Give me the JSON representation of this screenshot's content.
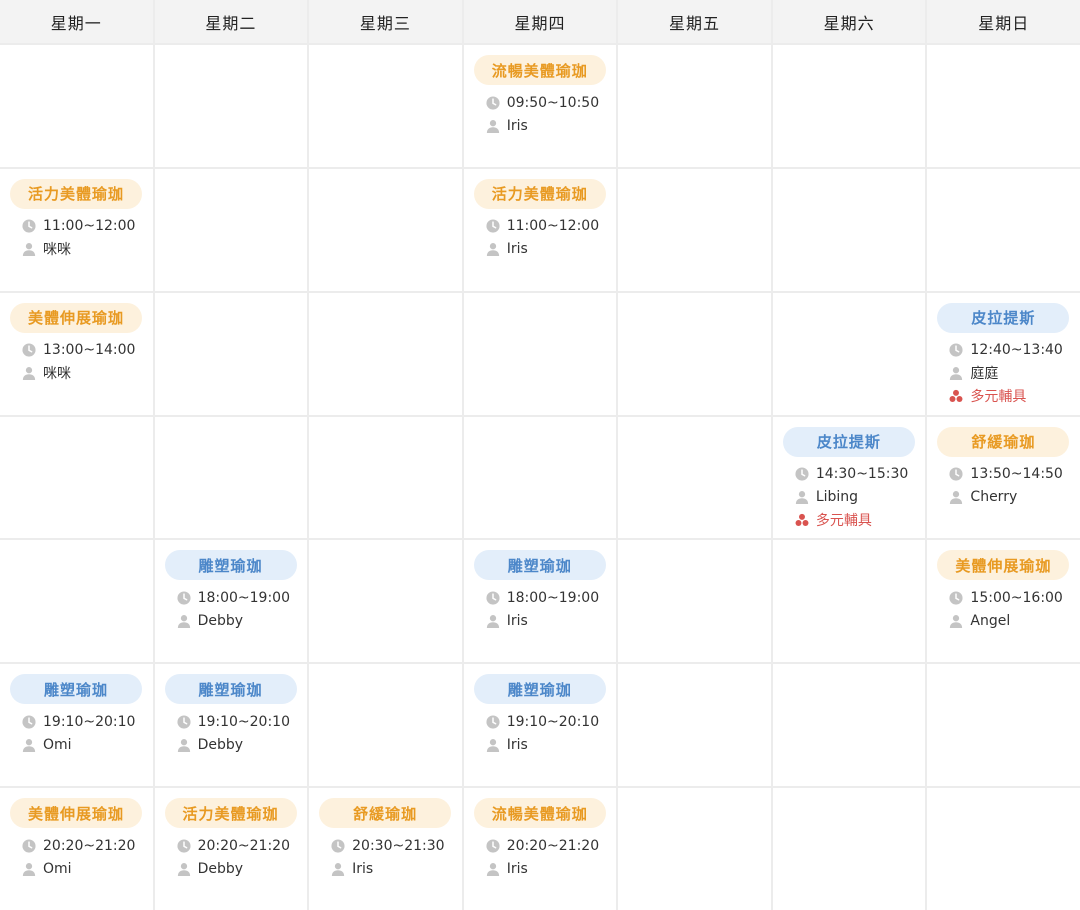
{
  "days": [
    "星期一",
    "星期二",
    "星期三",
    "星期四",
    "星期五",
    "星期六",
    "星期日"
  ],
  "colors": {
    "orange_text": "#e89a22",
    "orange_bg": "#fdf1dd",
    "blue_text": "#4c87c9",
    "blue_bg": "#e3eefa",
    "equip": "#d9534f",
    "icon": "#c2c2c2"
  },
  "icons": {
    "time": "clock-icon",
    "teacher": "person-icon",
    "equipment": "equipment-icon"
  },
  "classes": [
    {
      "day": 3,
      "slot": 0,
      "name": "流暢美體瑜珈",
      "color": "orange",
      "time": "09:50~10:50",
      "teacher": "Iris"
    },
    {
      "day": 0,
      "slot": 1,
      "name": "活力美體瑜珈",
      "color": "orange",
      "time": "11:00~12:00",
      "teacher": "咪咪"
    },
    {
      "day": 3,
      "slot": 1,
      "name": "活力美體瑜珈",
      "color": "orange",
      "time": "11:00~12:00",
      "teacher": "Iris"
    },
    {
      "day": 0,
      "slot": 2,
      "name": "美體伸展瑜珈",
      "color": "orange",
      "time": "13:00~14:00",
      "teacher": "咪咪"
    },
    {
      "day": 6,
      "slot": 2,
      "name": "皮拉提斯",
      "color": "blue",
      "time": "12:40~13:40",
      "teacher": "庭庭",
      "equipment": "多元輔具"
    },
    {
      "day": 5,
      "slot": 3,
      "name": "皮拉提斯",
      "color": "blue",
      "time": "14:30~15:30",
      "teacher": "Libing",
      "equipment": "多元輔具"
    },
    {
      "day": 6,
      "slot": 3,
      "name": "舒緩瑜珈",
      "color": "orange",
      "time": "13:50~14:50",
      "teacher": "Cherry"
    },
    {
      "day": 1,
      "slot": 4,
      "name": "雕塑瑜珈",
      "color": "blue",
      "time": "18:00~19:00",
      "teacher": "Debby"
    },
    {
      "day": 3,
      "slot": 4,
      "name": "雕塑瑜珈",
      "color": "blue",
      "time": "18:00~19:00",
      "teacher": "Iris"
    },
    {
      "day": 6,
      "slot": 4,
      "name": "美體伸展瑜珈",
      "color": "orange",
      "time": "15:00~16:00",
      "teacher": "Angel"
    },
    {
      "day": 0,
      "slot": 5,
      "name": "雕塑瑜珈",
      "color": "blue",
      "time": "19:10~20:10",
      "teacher": "Omi"
    },
    {
      "day": 1,
      "slot": 5,
      "name": "雕塑瑜珈",
      "color": "blue",
      "time": "19:10~20:10",
      "teacher": "Debby"
    },
    {
      "day": 3,
      "slot": 5,
      "name": "雕塑瑜珈",
      "color": "blue",
      "time": "19:10~20:10",
      "teacher": "Iris"
    },
    {
      "day": 0,
      "slot": 6,
      "name": "美體伸展瑜珈",
      "color": "orange",
      "time": "20:20~21:20",
      "teacher": "Omi"
    },
    {
      "day": 1,
      "slot": 6,
      "name": "活力美體瑜珈",
      "color": "orange",
      "time": "20:20~21:20",
      "teacher": "Debby"
    },
    {
      "day": 2,
      "slot": 6,
      "name": "舒緩瑜珈",
      "color": "orange",
      "time": "20:30~21:30",
      "teacher": "Iris"
    },
    {
      "day": 3,
      "slot": 6,
      "name": "流暢美體瑜珈",
      "color": "orange",
      "time": "20:20~21:20",
      "teacher": "Iris"
    }
  ]
}
